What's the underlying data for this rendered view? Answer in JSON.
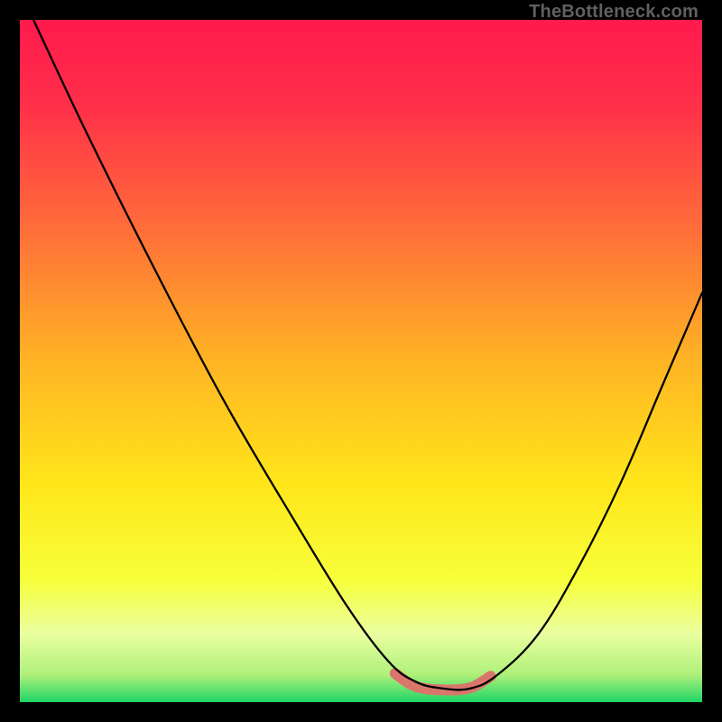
{
  "watermark": "TheBottleneck.com",
  "gradient_stops": [
    {
      "offset": 0.0,
      "color": "#ff1a4d"
    },
    {
      "offset": 0.12,
      "color": "#ff2e49"
    },
    {
      "offset": 0.3,
      "color": "#ff6b3a"
    },
    {
      "offset": 0.5,
      "color": "#ffb424"
    },
    {
      "offset": 0.68,
      "color": "#ffe61a"
    },
    {
      "offset": 0.82,
      "color": "#f7ff3a"
    },
    {
      "offset": 0.9,
      "color": "#eaffa0"
    },
    {
      "offset": 0.96,
      "color": "#aef07a"
    },
    {
      "offset": 1.0,
      "color": "#1fd566"
    }
  ],
  "chart_data": {
    "type": "line",
    "title": "",
    "xlabel": "",
    "ylabel": "",
    "xlim": [
      0,
      100
    ],
    "ylim": [
      0,
      100
    ],
    "legend": false,
    "grid": false,
    "annotations": [],
    "series": [
      {
        "name": "bottleneck-curve",
        "color": "#000000",
        "stroke_width": 2.3,
        "x": [
          2,
          10,
          20,
          30,
          40,
          48,
          54,
          58,
          62,
          66,
          70,
          76,
          82,
          88,
          94,
          100
        ],
        "values": [
          100,
          83,
          63,
          44,
          27,
          14,
          6,
          3,
          2,
          2,
          4,
          10,
          20,
          32,
          46,
          60
        ]
      },
      {
        "name": "optimal-zone-marker",
        "color": "#d9766c",
        "stroke_width": 12,
        "linecap": "round",
        "x": [
          55,
          58,
          62,
          66,
          69
        ],
        "values": [
          4.2,
          2.3,
          1.8,
          2.1,
          3.8
        ]
      }
    ]
  }
}
